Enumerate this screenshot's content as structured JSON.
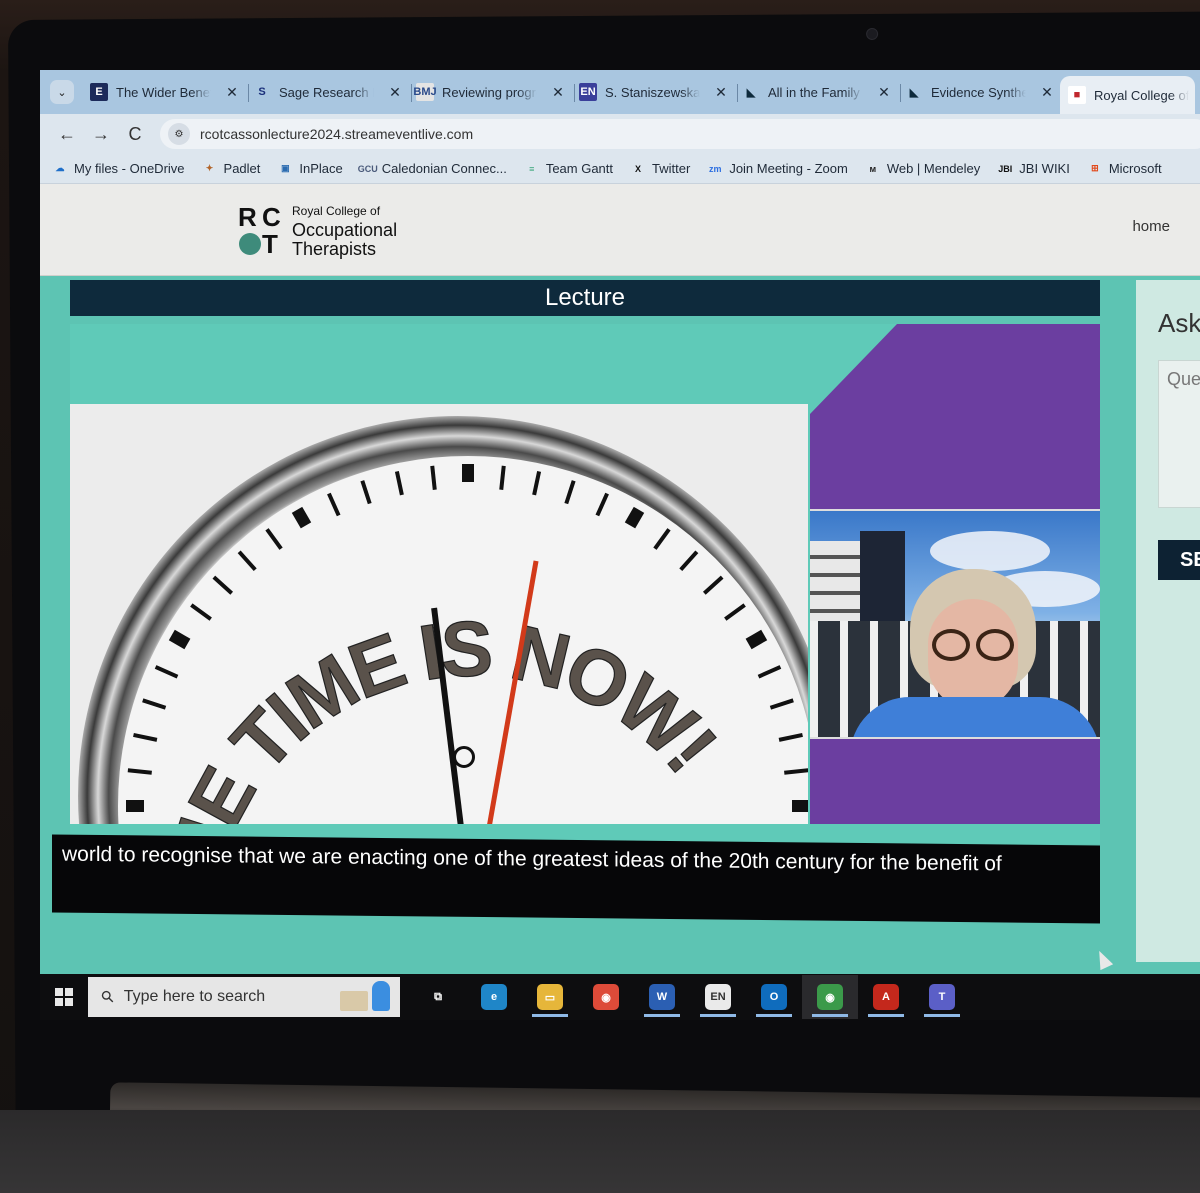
{
  "browser": {
    "tabs": [
      {
        "title": "The Wider Benefits",
        "favicon": "E",
        "favicon_bg": "#1c2a5a",
        "favicon_color": "#ffffff",
        "closable": true
      },
      {
        "title": "Sage Research Methods",
        "favicon": "S",
        "favicon_bg": "transparent",
        "favicon_color": "#1a2f7a",
        "closable": true
      },
      {
        "title": "Reviewing progress",
        "favicon": "BMJ",
        "favicon_bg": "#e4e4e4",
        "favicon_color": "#2a4a8a",
        "closable": true
      },
      {
        "title": "S. Staniszewska",
        "favicon": "EN",
        "favicon_bg": "#3a3f9a",
        "favicon_color": "#ffffff",
        "closable": true
      },
      {
        "title": "All in the Family",
        "favicon": "◣",
        "favicon_bg": "transparent",
        "favicon_color": "#0e2a3c",
        "closable": true
      },
      {
        "title": "Evidence Synthesis",
        "favicon": "◣",
        "favicon_bg": "transparent",
        "favicon_color": "#0e2a3c",
        "closable": true
      },
      {
        "title": "Royal College of Occupational Therapists",
        "favicon": "■",
        "favicon_bg": "#ffffff",
        "favicon_color": "#c0262d",
        "active": true
      }
    ],
    "tab_search_icon": "chevron-down",
    "url": "rcotcassonlecture2024.streameventlive.com",
    "nav": {
      "back": "←",
      "forward": "→",
      "reload": "C",
      "site_info": "⚙"
    },
    "bookmarks": [
      {
        "label": "My files - OneDrive",
        "icon": "☁",
        "color": "#1f6fc9"
      },
      {
        "label": "Padlet",
        "icon": "✦",
        "color": "#b2652a"
      },
      {
        "label": "InPlace",
        "icon": "▣",
        "color": "#2a6bb0"
      },
      {
        "label": "Caledonian Connec...",
        "icon": "GCU",
        "color": "#4a5a7a"
      },
      {
        "label": "Team Gantt",
        "icon": "≡",
        "color": "#3aa67a"
      },
      {
        "label": "Twitter",
        "icon": "X",
        "color": "#111111"
      },
      {
        "label": "Join Meeting - Zoom",
        "icon": "zm",
        "color": "#2d6fe0"
      },
      {
        "label": "Web | Mendeley",
        "icon": "ᴍ",
        "color": "#222222"
      },
      {
        "label": "JBI WIKI",
        "icon": "JBI",
        "color": "#111111"
      },
      {
        "label": "Microsoft",
        "icon": "⊞",
        "color": "#e24a1c"
      }
    ]
  },
  "site": {
    "logo_letters": {
      "r": "R",
      "c": "C",
      "t": "T"
    },
    "logo_lines": [
      "Royal College of",
      "Occupational",
      "Therapists"
    ],
    "nav_home": "home",
    "lecture_heading": "Lecture",
    "slide_text": [
      "THE",
      "TIME",
      "IS",
      "NOW!"
    ],
    "captions": "world to recognise that  we are enacting one of the  greatest ideas of the 20th  century for the benefit of",
    "sidebar": {
      "heading": "Ask",
      "question_placeholder": "Question",
      "send_label": "SEND"
    },
    "colors": {
      "teal": "#5dc4b3",
      "navy": "#0e2a3c",
      "purple": "#6b3ea0",
      "logo_green": "#3e8b7b"
    }
  },
  "taskbar": {
    "search_placeholder": "Type here to search",
    "apps": [
      {
        "name": "task-view",
        "glyph": "⧉",
        "bg": "transparent",
        "open": false
      },
      {
        "name": "edge",
        "glyph": "e",
        "bg": "#1f86c8",
        "open": false
      },
      {
        "name": "file-explorer",
        "glyph": "▭",
        "bg": "#e6b63a",
        "open": true
      },
      {
        "name": "chrome",
        "glyph": "◉",
        "bg": "#dd4b39",
        "open": false
      },
      {
        "name": "word",
        "glyph": "W",
        "bg": "#2b5fb3",
        "open": true
      },
      {
        "name": "endnote",
        "glyph": "EN",
        "bg": "#eaeaea",
        "open": true
      },
      {
        "name": "outlook",
        "glyph": "O",
        "bg": "#0f6cbd",
        "open": true
      },
      {
        "name": "chrome-profile",
        "glyph": "◉",
        "bg": "#3b9a4a",
        "open": true,
        "active": true
      },
      {
        "name": "acrobat",
        "glyph": "A",
        "bg": "#c4281c",
        "open": true
      },
      {
        "name": "teams",
        "glyph": "T",
        "bg": "#5b5fc7",
        "open": true
      }
    ]
  }
}
